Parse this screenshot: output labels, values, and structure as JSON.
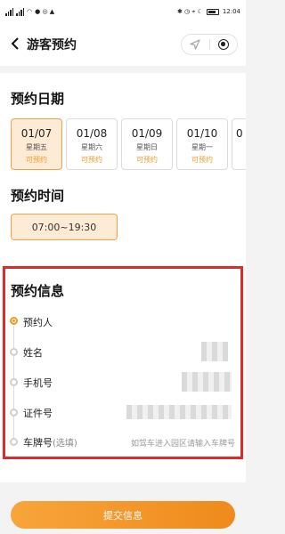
{
  "status_bar": {
    "time": "12:04"
  },
  "nav": {
    "title": "游客预约"
  },
  "date_section": {
    "title": "预约日期",
    "dates": [
      {
        "date": "01/07",
        "week": "星期五",
        "status": "可预约",
        "selected": true
      },
      {
        "date": "01/08",
        "week": "星期六",
        "status": "可预约",
        "selected": false
      },
      {
        "date": "01/09",
        "week": "星期日",
        "status": "可预约",
        "selected": false
      },
      {
        "date": "01/10",
        "week": "星期一",
        "status": "可预约",
        "selected": false
      },
      {
        "date": "0",
        "week": "",
        "status": "",
        "selected": false
      }
    ]
  },
  "time_section": {
    "title": "预约时间",
    "slot": "07:00~19:30"
  },
  "info_section": {
    "title": "预约信息",
    "booker_label": "预约人",
    "name_label": "姓名",
    "phone_label": "手机号",
    "id_label": "证件号",
    "plate_label": "车牌号",
    "plate_optional": "(选填)",
    "plate_placeholder": "如驾车进入园区请输入车牌号"
  },
  "submit_label": "提交信息",
  "colors": {
    "accent": "#f19a2a",
    "highlight_border": "#e02a2a",
    "selected_bg": "#fdebd6"
  }
}
